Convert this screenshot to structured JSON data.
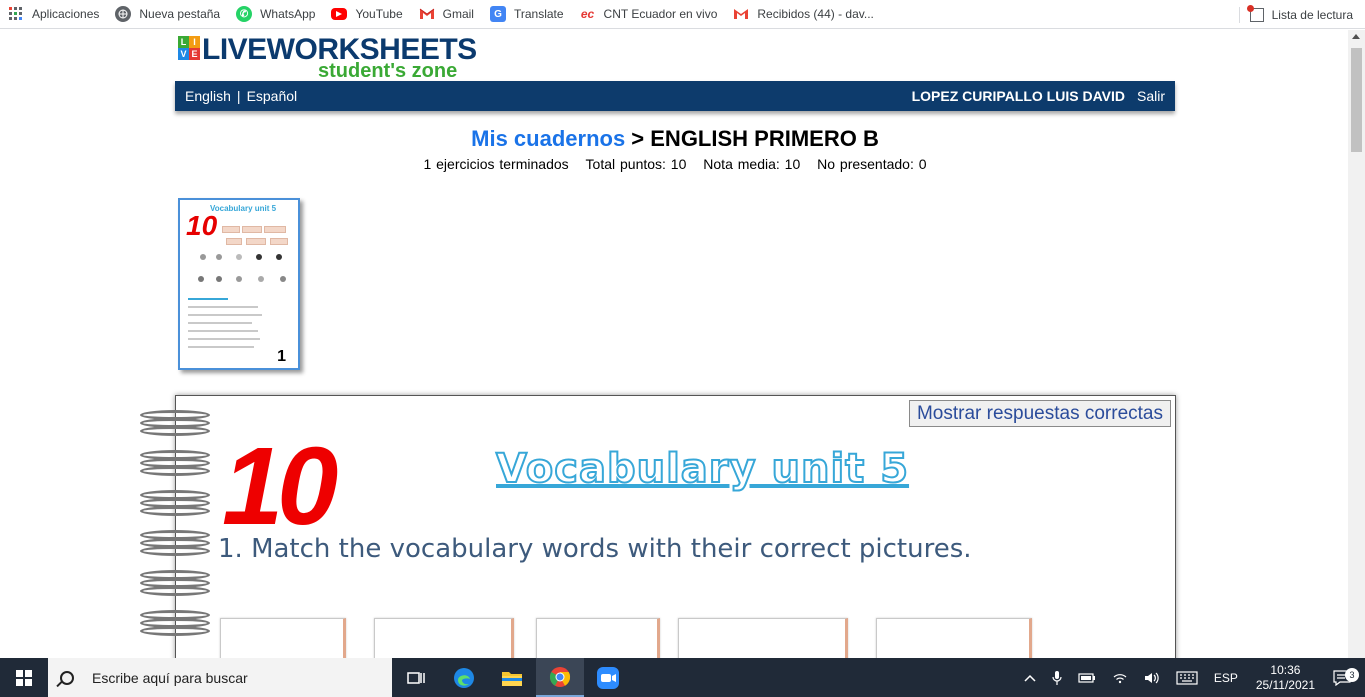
{
  "bookmarks": [
    {
      "label": "Aplicaciones",
      "icon": "apps-grid-icon"
    },
    {
      "label": "Nueva pestaña",
      "icon": "globe-icon"
    },
    {
      "label": "WhatsApp",
      "icon": "whatsapp-icon"
    },
    {
      "label": "YouTube",
      "icon": "youtube-icon"
    },
    {
      "label": "Gmail",
      "icon": "gmail-icon"
    },
    {
      "label": "Translate",
      "icon": "translate-icon"
    },
    {
      "label": "CNT Ecuador en vivo",
      "icon": "ec-icon"
    },
    {
      "label": "Recibidos (44) - dav...",
      "icon": "gmail-icon"
    }
  ],
  "reading_list": "Lista de lectura",
  "logo": {
    "main": "LIVEWORKSHEETS",
    "sub": "student's zone",
    "badge": [
      "L",
      "I",
      "V",
      "E"
    ]
  },
  "nav": {
    "english": "English",
    "separator": "|",
    "spanish": "Español",
    "user": "LOPEZ CURIPALLO LUIS DAVID",
    "logout": "Salir"
  },
  "title": {
    "link": "Mis cuadernos",
    "rest": " > ENGLISH PRIMERO B"
  },
  "stats": [
    "1 ejercicios terminados",
    "Total puntos: 10",
    "Nota media: 10",
    "No presentado: 0"
  ],
  "thumbnail": {
    "title": "Vocabulary unit 5",
    "score": "10",
    "number": "1"
  },
  "worksheet": {
    "show_answers": "Mostrar respuestas correctas",
    "score": "10",
    "heading": "Vocabulary unit 5",
    "instruction": "1. Match the vocabulary words with their correct pictures."
  },
  "taskbar": {
    "search_placeholder": "Escribe aquí para buscar",
    "lang": "ESP",
    "time": "10:36",
    "date": "25/11/2021",
    "notifications": "3"
  },
  "colors": {
    "navbar": "#0d3b6c",
    "link": "#1a73e8",
    "score": "#ee0000",
    "heading_stroke": "#37a7d8",
    "logo_green": "#3aa935"
  }
}
